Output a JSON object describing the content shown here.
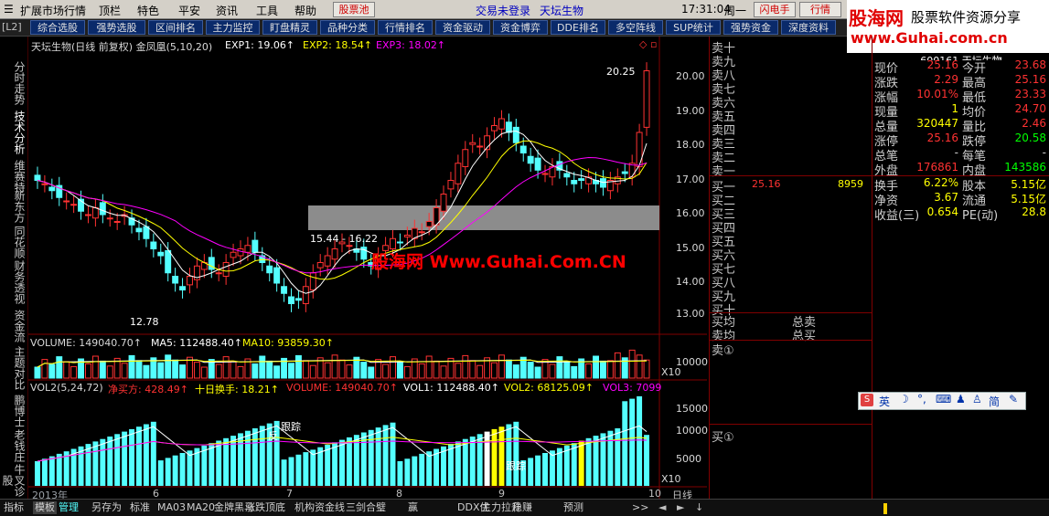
{
  "menu": {
    "items": [
      "扩展市场行情",
      "顶栏",
      "特色",
      "平安",
      "资讯",
      "工具",
      "帮助"
    ],
    "stock_pool": "股票池",
    "login_status": "交易未登录",
    "stock_name": "天坛生物",
    "time": "17:31:04",
    "weekday": "周一",
    "flash_btn": "闪电手",
    "quote_btn": "行情",
    "window_btns": [
      "_",
      "□",
      "×"
    ]
  },
  "logo": {
    "brand": "股海网",
    "slogan": "股票软件资源分享",
    "url": "www.Guhai.com.cn"
  },
  "toolbar": {
    "tag": "[L2]",
    "buttons": [
      "综合选股",
      "强势选股",
      "区间排名",
      "主力监控",
      "盯盘精灵",
      "品种分类",
      "行情排名",
      "资金驱动",
      "资金博弈",
      "DDE排名",
      "多空阵线",
      "SUP统计",
      "强势资金",
      "深度资料"
    ]
  },
  "left_tabs": [
    "分时走势",
    "技术分析",
    "维赛特",
    "新东方",
    "同花顺",
    "财务透视",
    "资金流",
    "主题对比",
    "鹏博士",
    "老钱庄",
    "牛叉诊股"
  ],
  "main_chart": {
    "header": {
      "title": "天坛生物(日线 前复权) 金凤凰(5,10,20)",
      "exp1": "EXP1: 19.06↑",
      "exp2": "EXP2: 18.54↑",
      "exp3": "EXP3: 18.02↑"
    },
    "price_ticks": [
      "20.00",
      "19.00",
      "18.00",
      "17.00",
      "16.00",
      "15.00",
      "14.00",
      "13.00"
    ],
    "high_label": "20.25",
    "low_label": "12.78",
    "range_label": "15.44 - 16.22",
    "colors": {
      "up": "#ff3232",
      "down": "#54ffff",
      "ma_white": "#ffffff",
      "ma_yellow": "#ffff00",
      "ma_purple": "#ff00ff",
      "highlight": "#8c8c8c"
    }
  },
  "volume_panel": {
    "vol": "VOLUME: 149040.70↑",
    "ma5": "MA5: 112488.40↑",
    "ma10": "MA10: 93859.30↑",
    "tick": "10000",
    "unit": "X10"
  },
  "vol2_panel": {
    "name": "VOL2(5,24,72)",
    "net_buy": "净买方: 428.49↑",
    "turnover": "十日换手: 18.21↑",
    "volume": "VOLUME: 149040.70↑",
    "vol1": "VOL1: 112488.40↑",
    "vol2": "VOL2: 68125.09↑",
    "vol3": "VOL3: 7099",
    "ticks": [
      "15000",
      "10000",
      "5000"
    ],
    "unit": "X10",
    "tag_fan": "反",
    "tag_track1": "跟踪",
    "tag_track2": "跟踪"
  },
  "date_axis": {
    "year": "2013年",
    "months": [
      "6",
      "7",
      "8",
      "9",
      "10"
    ],
    "period": "日线"
  },
  "order_book": {
    "sells": [
      "卖十",
      "卖九",
      "卖八",
      "卖七",
      "卖六",
      "卖五",
      "卖四",
      "卖三",
      "卖二",
      "卖一"
    ],
    "buys": [
      "买一",
      "买二",
      "买三",
      "买四",
      "买五",
      "买六",
      "买七",
      "买八",
      "买九",
      "买十"
    ],
    "buy1_price": "25.16",
    "buy1_volume": "8959",
    "avg_buy_label": "买均",
    "avg_sell_label": "卖均",
    "total_sell_label": "总卖",
    "total_buy_label": "总买",
    "sell_circle": "卖①",
    "buy_circle": "买①"
  },
  "quote": {
    "code_name": "600161 天坛生物",
    "rows": [
      {
        "k1": "现价",
        "v1": "25.16",
        "c1": "#ff3232",
        "k2": "今开",
        "v2": "23.68",
        "c2": "#ff3232"
      },
      {
        "k1": "涨跌",
        "v1": "2.29",
        "c1": "#ff3232",
        "k2": "最高",
        "v2": "25.16",
        "c2": "#ff3232"
      },
      {
        "k1": "涨幅",
        "v1": "10.01%",
        "c1": "#ff3232",
        "k2": "最低",
        "v2": "23.33",
        "c2": "#ff3232"
      },
      {
        "k1": "现量",
        "v1": "1",
        "c1": "#ffff00",
        "k2": "均价",
        "v2": "24.70",
        "c2": "#ff3232"
      },
      {
        "k1": "总量",
        "v1": "320447",
        "c1": "#ffff00",
        "k2": "量比",
        "v2": "2.46",
        "c2": "#ff3232"
      },
      {
        "k1": "涨停",
        "v1": "25.16",
        "c1": "#ff3232",
        "k2": "跌停",
        "v2": "20.58",
        "c2": "#00ff00"
      },
      {
        "k1": "总笔",
        "v1": "-",
        "c1": "#d0d0d0",
        "k2": "每笔",
        "v2": "-",
        "c2": "#d0d0d0"
      },
      {
        "k1": "外盘",
        "v1": "176861",
        "c1": "#ff3232",
        "k2": "内盘",
        "v2": "143586",
        "c2": "#00ff00"
      },
      {
        "k1": "换手",
        "v1": "6.22%",
        "c1": "#ffff00",
        "k2": "股本",
        "v2": "5.15亿",
        "c2": "#ffff00"
      },
      {
        "k1": "净资",
        "v1": "3.67",
        "c1": "#ffff00",
        "k2": "流通",
        "v2": "5.15亿",
        "c2": "#ffff00"
      },
      {
        "k1": "收益(三)",
        "v1": "0.654",
        "c1": "#ffff00",
        "k2": "PE(动)",
        "v2": "28.8",
        "c2": "#ffff00"
      }
    ]
  },
  "watermark": {
    "text": "股海网 Www.Guhai.Com.CN"
  },
  "ime": {
    "label": "英",
    "icons": [
      "moon-icon",
      "comma-icon",
      "keyboard-icon",
      "person-icon",
      "shirt-icon",
      "jian-icon",
      "wrench-icon"
    ],
    "jian": "简"
  },
  "bottom_tabs": [
    "指标",
    "模板",
    "管理",
    "另存为",
    "标准",
    "MA03",
    "MA20",
    "金牌黑马",
    "涨跌顶底",
    "机构资金线",
    "三剑合璧",
    "赢",
    "DDX优",
    "主力拉升",
    "稳赚",
    "预测"
  ],
  "bottom_more": ">>"
}
